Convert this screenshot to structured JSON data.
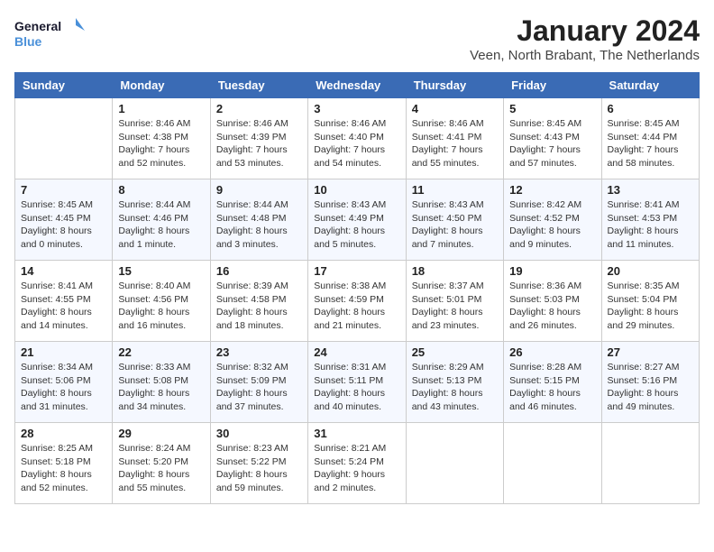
{
  "logo": {
    "line1": "General",
    "line2": "Blue"
  },
  "title": "January 2024",
  "subtitle": "Veen, North Brabant, The Netherlands",
  "weekdays": [
    "Sunday",
    "Monday",
    "Tuesday",
    "Wednesday",
    "Thursday",
    "Friday",
    "Saturday"
  ],
  "weeks": [
    [
      {
        "day": "",
        "info": ""
      },
      {
        "day": "1",
        "info": "Sunrise: 8:46 AM\nSunset: 4:38 PM\nDaylight: 7 hours\nand 52 minutes."
      },
      {
        "day": "2",
        "info": "Sunrise: 8:46 AM\nSunset: 4:39 PM\nDaylight: 7 hours\nand 53 minutes."
      },
      {
        "day": "3",
        "info": "Sunrise: 8:46 AM\nSunset: 4:40 PM\nDaylight: 7 hours\nand 54 minutes."
      },
      {
        "day": "4",
        "info": "Sunrise: 8:46 AM\nSunset: 4:41 PM\nDaylight: 7 hours\nand 55 minutes."
      },
      {
        "day": "5",
        "info": "Sunrise: 8:45 AM\nSunset: 4:43 PM\nDaylight: 7 hours\nand 57 minutes."
      },
      {
        "day": "6",
        "info": "Sunrise: 8:45 AM\nSunset: 4:44 PM\nDaylight: 7 hours\nand 58 minutes."
      }
    ],
    [
      {
        "day": "7",
        "info": "Sunrise: 8:45 AM\nSunset: 4:45 PM\nDaylight: 8 hours\nand 0 minutes."
      },
      {
        "day": "8",
        "info": "Sunrise: 8:44 AM\nSunset: 4:46 PM\nDaylight: 8 hours\nand 1 minute."
      },
      {
        "day": "9",
        "info": "Sunrise: 8:44 AM\nSunset: 4:48 PM\nDaylight: 8 hours\nand 3 minutes."
      },
      {
        "day": "10",
        "info": "Sunrise: 8:43 AM\nSunset: 4:49 PM\nDaylight: 8 hours\nand 5 minutes."
      },
      {
        "day": "11",
        "info": "Sunrise: 8:43 AM\nSunset: 4:50 PM\nDaylight: 8 hours\nand 7 minutes."
      },
      {
        "day": "12",
        "info": "Sunrise: 8:42 AM\nSunset: 4:52 PM\nDaylight: 8 hours\nand 9 minutes."
      },
      {
        "day": "13",
        "info": "Sunrise: 8:41 AM\nSunset: 4:53 PM\nDaylight: 8 hours\nand 11 minutes."
      }
    ],
    [
      {
        "day": "14",
        "info": "Sunrise: 8:41 AM\nSunset: 4:55 PM\nDaylight: 8 hours\nand 14 minutes."
      },
      {
        "day": "15",
        "info": "Sunrise: 8:40 AM\nSunset: 4:56 PM\nDaylight: 8 hours\nand 16 minutes."
      },
      {
        "day": "16",
        "info": "Sunrise: 8:39 AM\nSunset: 4:58 PM\nDaylight: 8 hours\nand 18 minutes."
      },
      {
        "day": "17",
        "info": "Sunrise: 8:38 AM\nSunset: 4:59 PM\nDaylight: 8 hours\nand 21 minutes."
      },
      {
        "day": "18",
        "info": "Sunrise: 8:37 AM\nSunset: 5:01 PM\nDaylight: 8 hours\nand 23 minutes."
      },
      {
        "day": "19",
        "info": "Sunrise: 8:36 AM\nSunset: 5:03 PM\nDaylight: 8 hours\nand 26 minutes."
      },
      {
        "day": "20",
        "info": "Sunrise: 8:35 AM\nSunset: 5:04 PM\nDaylight: 8 hours\nand 29 minutes."
      }
    ],
    [
      {
        "day": "21",
        "info": "Sunrise: 8:34 AM\nSunset: 5:06 PM\nDaylight: 8 hours\nand 31 minutes."
      },
      {
        "day": "22",
        "info": "Sunrise: 8:33 AM\nSunset: 5:08 PM\nDaylight: 8 hours\nand 34 minutes."
      },
      {
        "day": "23",
        "info": "Sunrise: 8:32 AM\nSunset: 5:09 PM\nDaylight: 8 hours\nand 37 minutes."
      },
      {
        "day": "24",
        "info": "Sunrise: 8:31 AM\nSunset: 5:11 PM\nDaylight: 8 hours\nand 40 minutes."
      },
      {
        "day": "25",
        "info": "Sunrise: 8:29 AM\nSunset: 5:13 PM\nDaylight: 8 hours\nand 43 minutes."
      },
      {
        "day": "26",
        "info": "Sunrise: 8:28 AM\nSunset: 5:15 PM\nDaylight: 8 hours\nand 46 minutes."
      },
      {
        "day": "27",
        "info": "Sunrise: 8:27 AM\nSunset: 5:16 PM\nDaylight: 8 hours\nand 49 minutes."
      }
    ],
    [
      {
        "day": "28",
        "info": "Sunrise: 8:25 AM\nSunset: 5:18 PM\nDaylight: 8 hours\nand 52 minutes."
      },
      {
        "day": "29",
        "info": "Sunrise: 8:24 AM\nSunset: 5:20 PM\nDaylight: 8 hours\nand 55 minutes."
      },
      {
        "day": "30",
        "info": "Sunrise: 8:23 AM\nSunset: 5:22 PM\nDaylight: 8 hours\nand 59 minutes."
      },
      {
        "day": "31",
        "info": "Sunrise: 8:21 AM\nSunset: 5:24 PM\nDaylight: 9 hours\nand 2 minutes."
      },
      {
        "day": "",
        "info": ""
      },
      {
        "day": "",
        "info": ""
      },
      {
        "day": "",
        "info": ""
      }
    ]
  ]
}
